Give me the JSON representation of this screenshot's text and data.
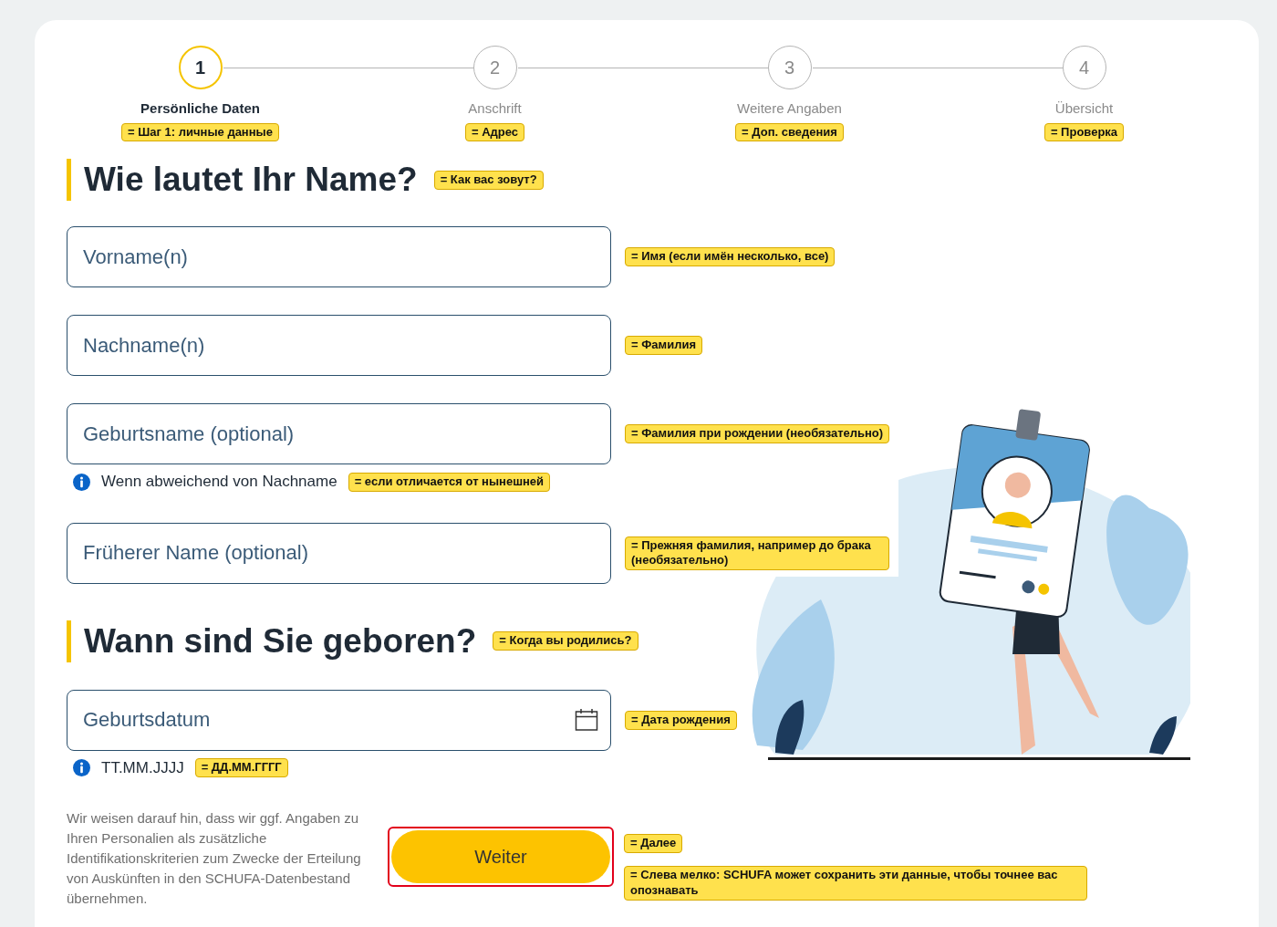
{
  "steps": [
    {
      "number": "1",
      "label": "Persönliche Daten",
      "note": "= Шаг 1: личные данные",
      "selected": true
    },
    {
      "number": "2",
      "label": "Anschrift",
      "note": "= Адрес",
      "selected": false
    },
    {
      "number": "3",
      "label": "Weitere Angaben",
      "note": "= Доп. сведения",
      "selected": false
    },
    {
      "number": "4",
      "label": "Übersicht",
      "note": "= Проверка",
      "selected": false
    }
  ],
  "sections": [
    {
      "heading": "Wie lautet Ihr Name?",
      "heading_note": "= Как вас зовут?",
      "fields": [
        {
          "kind": "text",
          "placeholder": "Vorname(n)",
          "note": "= Имя (если имён несколько, все)"
        },
        {
          "kind": "text",
          "placeholder": "Nachname(n)",
          "note": "= Фамилия"
        },
        {
          "kind": "text",
          "placeholder": "Geburtsname (optional)",
          "note": "= Фамилия при рождении (необязательно)",
          "hint": "Wenn abweichend von Nachname",
          "hint_note": "= если отличается от нынешней"
        },
        {
          "kind": "text",
          "placeholder": "Früherer Name (optional)",
          "note": "= Прежняя фамилия, например до брака (необязательно)"
        }
      ]
    },
    {
      "heading": "Wann sind Sie geboren?",
      "heading_note": "= Когда вы родились?",
      "fields": [
        {
          "kind": "date",
          "placeholder": "Geburtsdatum",
          "note": "= Дата рождения",
          "hint": "TT.MM.JJJJ",
          "hint_note": "= ДД.ММ.ГГГГ"
        }
      ]
    }
  ],
  "footer": {
    "disclaimer": "Wir weisen darauf hin, dass wir ggf. Angaben zu Ihren Personalien als zusätzliche Identifikationskriterien zum Zwecke der Erteilung von Auskünften in den SCHUFA-Datenbestand übernehmen.",
    "button": {
      "label": "Weiter",
      "highlighted": true,
      "note": "= Далее"
    },
    "note": "= Слева мелко: SCHUFA может сохранить эти данные, чтобы точнее вас опознавать"
  }
}
